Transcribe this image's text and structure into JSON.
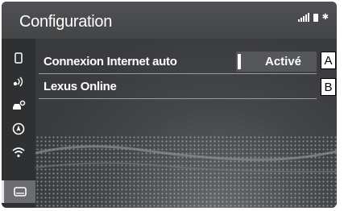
{
  "header": {
    "title": "Configuration"
  },
  "status": {
    "signal_icon": "signal-bars-icon",
    "battery_icon": "battery-icon",
    "bluetooth_icon": "bluetooth-icon"
  },
  "sidebar": {
    "items": [
      {
        "icon": "phone-icon"
      },
      {
        "icon": "voice-icon"
      },
      {
        "icon": "car-settings-icon"
      },
      {
        "icon": "navigation-icon"
      },
      {
        "icon": "wifi-icon"
      },
      {
        "icon": "display-icon",
        "active": true
      }
    ]
  },
  "settings": {
    "rows": [
      {
        "label": "Connexion Internet auto",
        "value": "Activé"
      },
      {
        "label": "Lexus Online"
      }
    ]
  },
  "callouts": {
    "a": "A",
    "b": "B"
  }
}
